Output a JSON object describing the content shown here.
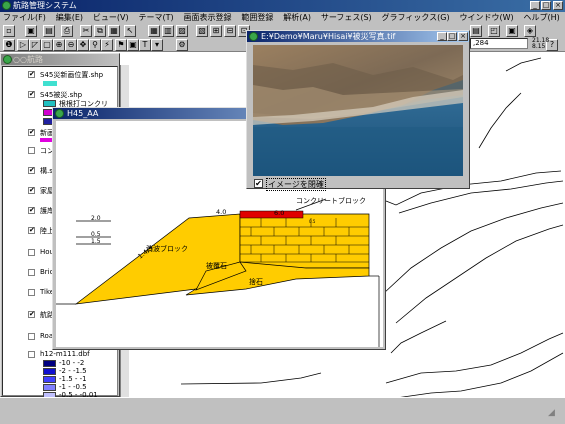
{
  "app": {
    "title": "航路管理システム",
    "btn_min": "_",
    "btn_max": "□",
    "btn_close": "×"
  },
  "menu": [
    "ファイル(F)",
    "編集(E)",
    "ビュー(V)",
    "テーマ(T)",
    "画面表示登録",
    "範囲登録",
    "解析(A)",
    "サーフェス(S)",
    "グラフィックス(G)",
    "ウインドウ(W)",
    "ヘルプ(H)"
  ],
  "status": {
    "coord1": ",284",
    "coord2": "21.18",
    "coord3": "8.15"
  },
  "layers": {
    "title": "○○航路",
    "items": [
      {
        "name": "S45災新画位置.shp",
        "checked": true
      },
      {
        "name": "S45被災.shp",
        "checked": true
      },
      {
        "name": "新画",
        "checked": true
      },
      {
        "name": "コン",
        "checked": false
      },
      {
        "name": "構.s",
        "checked": true
      },
      {
        "name": "家屋",
        "checked": true
      },
      {
        "name": "護岸",
        "checked": true
      },
      {
        "name": "陸上",
        "checked": true
      },
      {
        "name": "Hous",
        "checked": false
      },
      {
        "name": "Bric",
        "checked": false
      },
      {
        "name": "Tike",
        "checked": false
      },
      {
        "name": "航路",
        "checked": true
      },
      {
        "name": "Roac",
        "checked": false
      },
      {
        "name": "h12-m111.dbf",
        "checked": false
      }
    ],
    "sublabel": "根根打コンクリ",
    "legend": [
      "-10 - -2",
      "-2 - -1.5",
      "-1.5 - -1",
      "-1 - -0.5",
      "-0.5 - -0.01"
    ],
    "legend_colors": [
      "#000080",
      "#1010d0",
      "#4040ff",
      "#8080ff",
      "#c0c0ff"
    ]
  },
  "photo": {
    "title": "E:¥Demo¥Maru¥Hisai¥被災写真.tif",
    "check_label": "イメージを閉確",
    "checked": true
  },
  "section": {
    "title": "H45_AA",
    "labels": {
      "top": "コンクリートブロック",
      "w1": "4.0",
      "w2": "6.0",
      "v1": "2.0",
      "v2": "0.5",
      "v3": "1.5",
      "slope": "1:4/3",
      "block": "消波ブロック",
      "stone": "被覆石",
      "base": "捨石",
      "small": "0.5"
    },
    "colors": {
      "fill": "#ffcc00",
      "red": "#e00000",
      "stroke": "#000000"
    }
  }
}
